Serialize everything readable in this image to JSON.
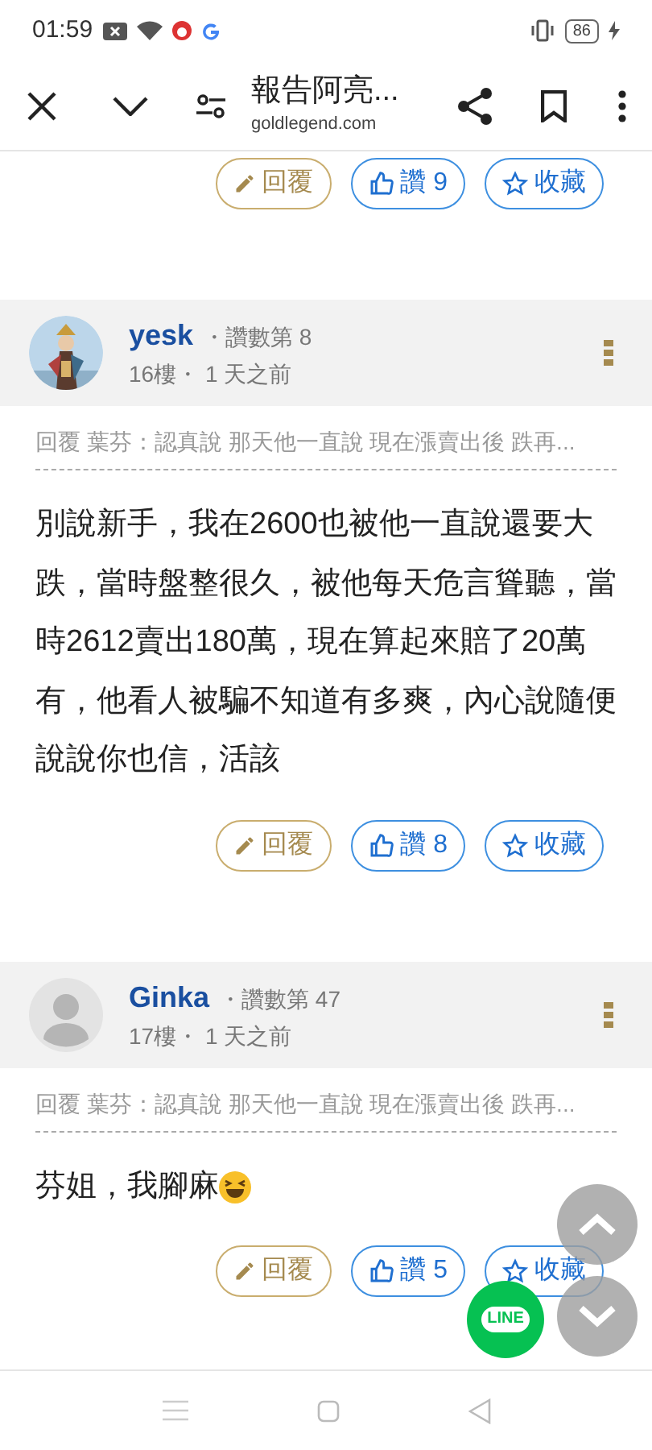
{
  "status_bar": {
    "time": "01:59",
    "battery": "86"
  },
  "toolbar": {
    "title": "報告阿亮...",
    "url": "goldlegend.com"
  },
  "top_actions": {
    "reply": "回覆",
    "like": "讚 9",
    "save": "收藏"
  },
  "posts": [
    {
      "author": "yesk",
      "reads": "・讚數第 8",
      "meta": "16樓・ 1 天之前",
      "photo_avatar": true,
      "quote": "回覆 葉芬：認真說 那天他一直說 現在漲賣出後 跌再...",
      "body": "別說新手，我在2600也被他一直說還要大跌，當時盤整很久，被他每天危言聳聽，當時2612賣出180萬，現在算起來賠了20萬有，他看人被騙不知道有多爽，內心說隨便說說你也信，活該",
      "emoji": false,
      "reply": "回覆",
      "like": "讚 8",
      "save": "收藏"
    },
    {
      "author": "Ginka",
      "reads": "・讚數第 47",
      "meta": "17樓・ 1 天之前",
      "photo_avatar": false,
      "quote": "回覆 葉芬：認真說 那天他一直說 現在漲賣出後 跌再...",
      "body": "芬姐，我腳麻",
      "emoji": true,
      "reply": "回覆",
      "like": "讚 5",
      "save": "收藏"
    }
  ],
  "line_button": {
    "label": "LINE"
  }
}
